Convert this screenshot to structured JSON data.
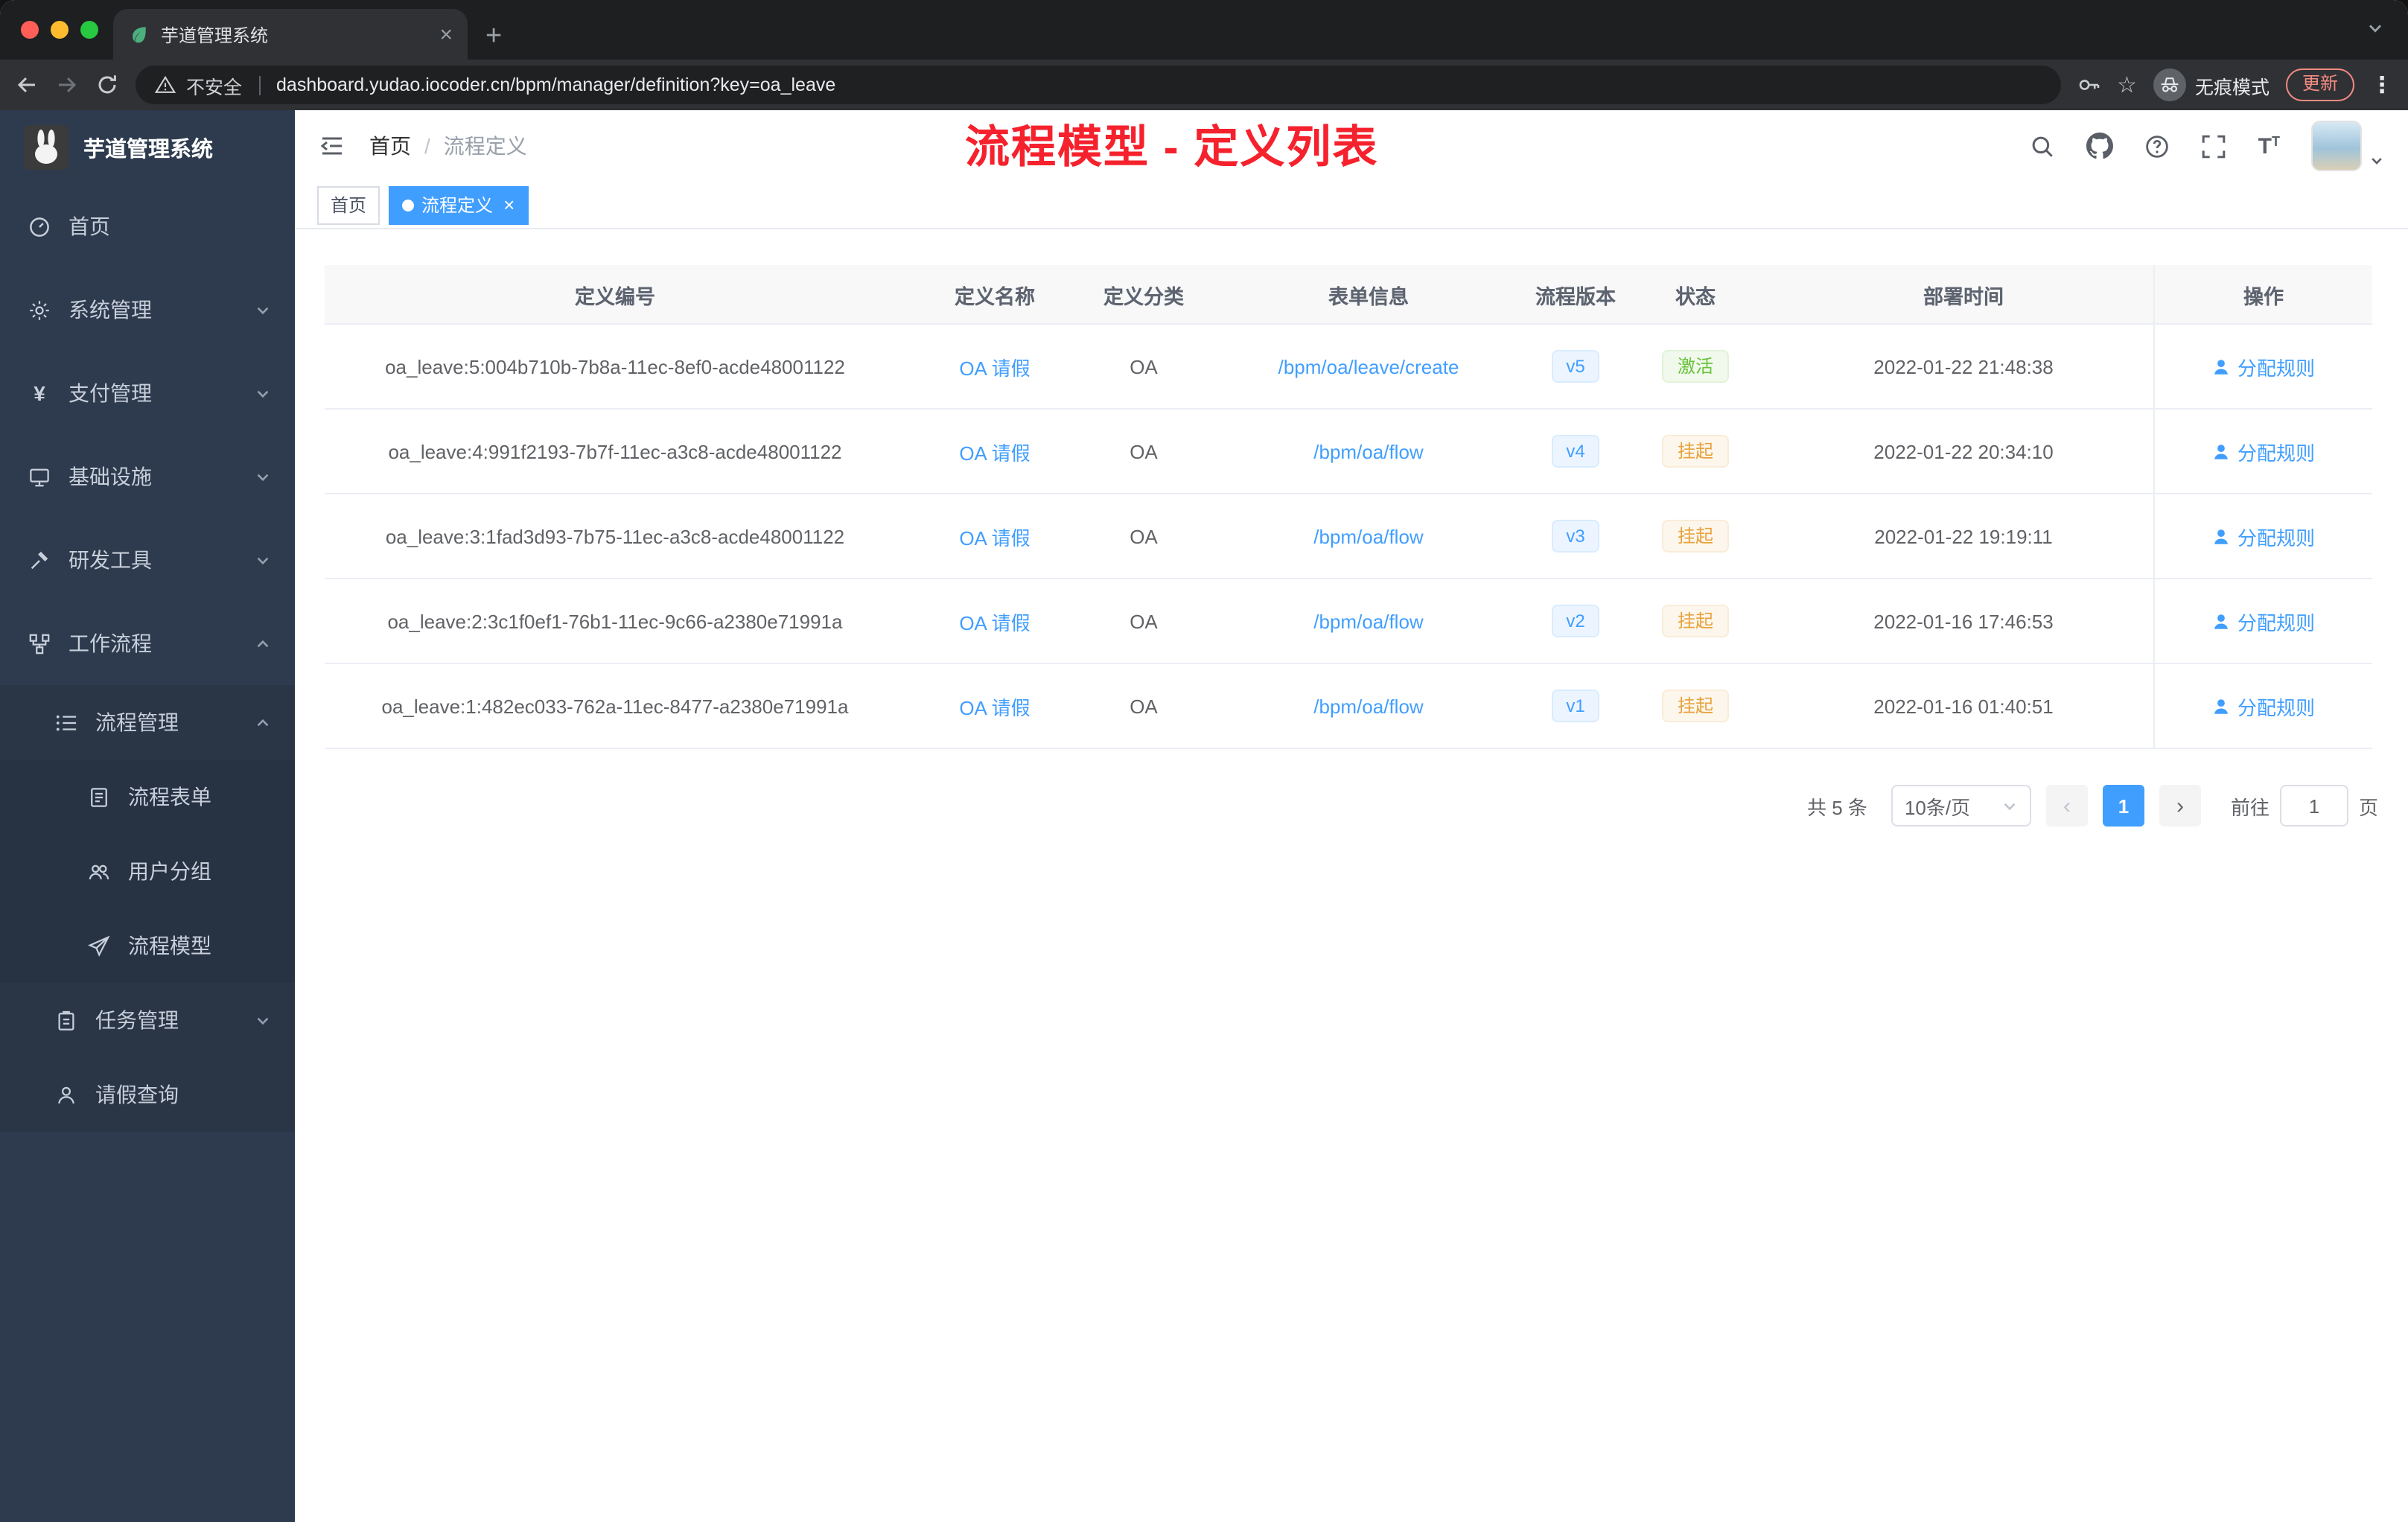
{
  "colors": {
    "accent": "#409eff",
    "annotation": "#f5222d",
    "success": "#67c23a",
    "warning": "#e6a23c",
    "sidebar_bg": "#2e3b4e"
  },
  "browser": {
    "tab_title": "芋道管理系统",
    "security_label": "不安全",
    "url": "dashboard.yudao.iocoder.cn/bpm/manager/definition?key=oa_leave",
    "incognito_label": "无痕模式",
    "update_label": "更新"
  },
  "sidebar": {
    "logo_title": "芋道管理系统",
    "items": [
      {
        "label": "首页"
      },
      {
        "label": "系统管理"
      },
      {
        "label": "支付管理"
      },
      {
        "label": "基础设施"
      },
      {
        "label": "研发工具"
      },
      {
        "label": "工作流程"
      },
      {
        "label": "流程管理"
      },
      {
        "label": "流程表单"
      },
      {
        "label": "用户分组"
      },
      {
        "label": "流程模型"
      },
      {
        "label": "任务管理"
      },
      {
        "label": "请假查询"
      }
    ]
  },
  "header": {
    "breadcrumb": {
      "home": "首页",
      "separator": "/",
      "current": "流程定义"
    },
    "annotation": "流程模型 - 定义列表"
  },
  "tags": {
    "home": "首页",
    "active": "流程定义"
  },
  "table": {
    "columns": [
      "定义编号",
      "定义名称",
      "定义分类",
      "表单信息",
      "流程版本",
      "状态",
      "部署时间",
      "操作"
    ],
    "rows": [
      {
        "id": "oa_leave:5:004b710b-7b8a-11ec-8ef0-acde48001122",
        "name": "OA 请假",
        "category": "OA",
        "form": "/bpm/oa/leave/create",
        "version": "v5",
        "status": "激活",
        "time": "2022-01-22 21:48:38",
        "action": "分配规则"
      },
      {
        "id": "oa_leave:4:991f2193-7b7f-11ec-a3c8-acde48001122",
        "name": "OA 请假",
        "category": "OA",
        "form": "/bpm/oa/flow",
        "version": "v4",
        "status": "挂起",
        "time": "2022-01-22 20:34:10",
        "action": "分配规则"
      },
      {
        "id": "oa_leave:3:1fad3d93-7b75-11ec-a3c8-acde48001122",
        "name": "OA 请假",
        "category": "OA",
        "form": "/bpm/oa/flow",
        "version": "v3",
        "status": "挂起",
        "time": "2022-01-22 19:19:11",
        "action": "分配规则"
      },
      {
        "id": "oa_leave:2:3c1f0ef1-76b1-11ec-9c66-a2380e71991a",
        "name": "OA 请假",
        "category": "OA",
        "form": "/bpm/oa/flow",
        "version": "v2",
        "status": "挂起",
        "time": "2022-01-16 17:46:53",
        "action": "分配规则"
      },
      {
        "id": "oa_leave:1:482ec033-762a-11ec-8477-a2380e71991a",
        "name": "OA 请假",
        "category": "OA",
        "form": "/bpm/oa/flow",
        "version": "v1",
        "status": "挂起",
        "time": "2022-01-16 01:40:51",
        "action": "分配规则"
      }
    ]
  },
  "pagination": {
    "total": "共 5 条",
    "page_size": "10条/页",
    "current": "1",
    "goto_label": "前往",
    "goto_page": "1",
    "goto_unit": "页"
  }
}
